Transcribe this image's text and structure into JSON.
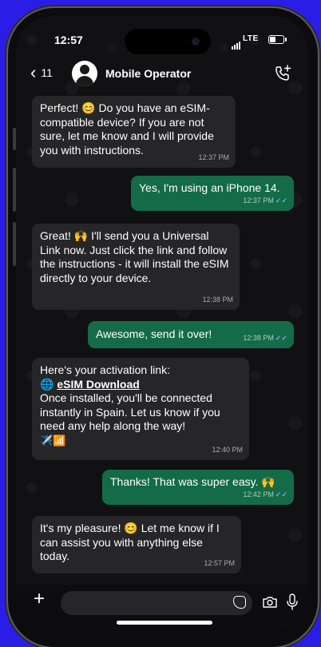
{
  "status_bar": {
    "time": "12:57",
    "network": "LTE"
  },
  "header": {
    "back_count": "11",
    "contact_name": "Mobile Operator"
  },
  "messages": [
    {
      "direction": "in",
      "text": "Perfect! 😊 Do you have an eSIM-compatible device? If you are not sure, let me know and I will provide you with instructions.",
      "time": "12:37 PM"
    },
    {
      "direction": "out",
      "text": "Yes, I'm using an iPhone 14.",
      "time": "12:37 PM"
    },
    {
      "direction": "in",
      "text": "Great! 🙌 I'll send you a Universal Link now. Just click the link and follow the instructions - it will install the eSIM directly to your device.",
      "time": "12:38 PM"
    },
    {
      "direction": "out",
      "text": "Awesome, send it over!",
      "time": "12:38 PM"
    },
    {
      "direction": "in",
      "text_before": "Here's your activation link:",
      "link_icon": "🌐",
      "link_text": "eSIM Download",
      "text_after": "Once installed, you'll be connected instantly in Spain. Let us know if you need any help along the way!",
      "emoji_line": "✈️📶",
      "time": "12:40 PM"
    },
    {
      "direction": "out",
      "text": "Thanks! That was super easy. 🙌",
      "time": "12:42 PM"
    },
    {
      "direction": "in",
      "text": "It's my pleasure! 😊 Let me know if I can assist you with anything else today.",
      "time": "12:57 PM"
    }
  ],
  "colors": {
    "incoming_bubble": "#262628",
    "outgoing_bubble": "#146b48",
    "read_ticks": "#8fd3ff",
    "background": "#2a1ee6"
  },
  "icons": [
    "chevron-left-icon",
    "avatar-icon",
    "add-call-icon",
    "plus-icon",
    "sticker-icon",
    "camera-icon",
    "microphone-icon"
  ]
}
